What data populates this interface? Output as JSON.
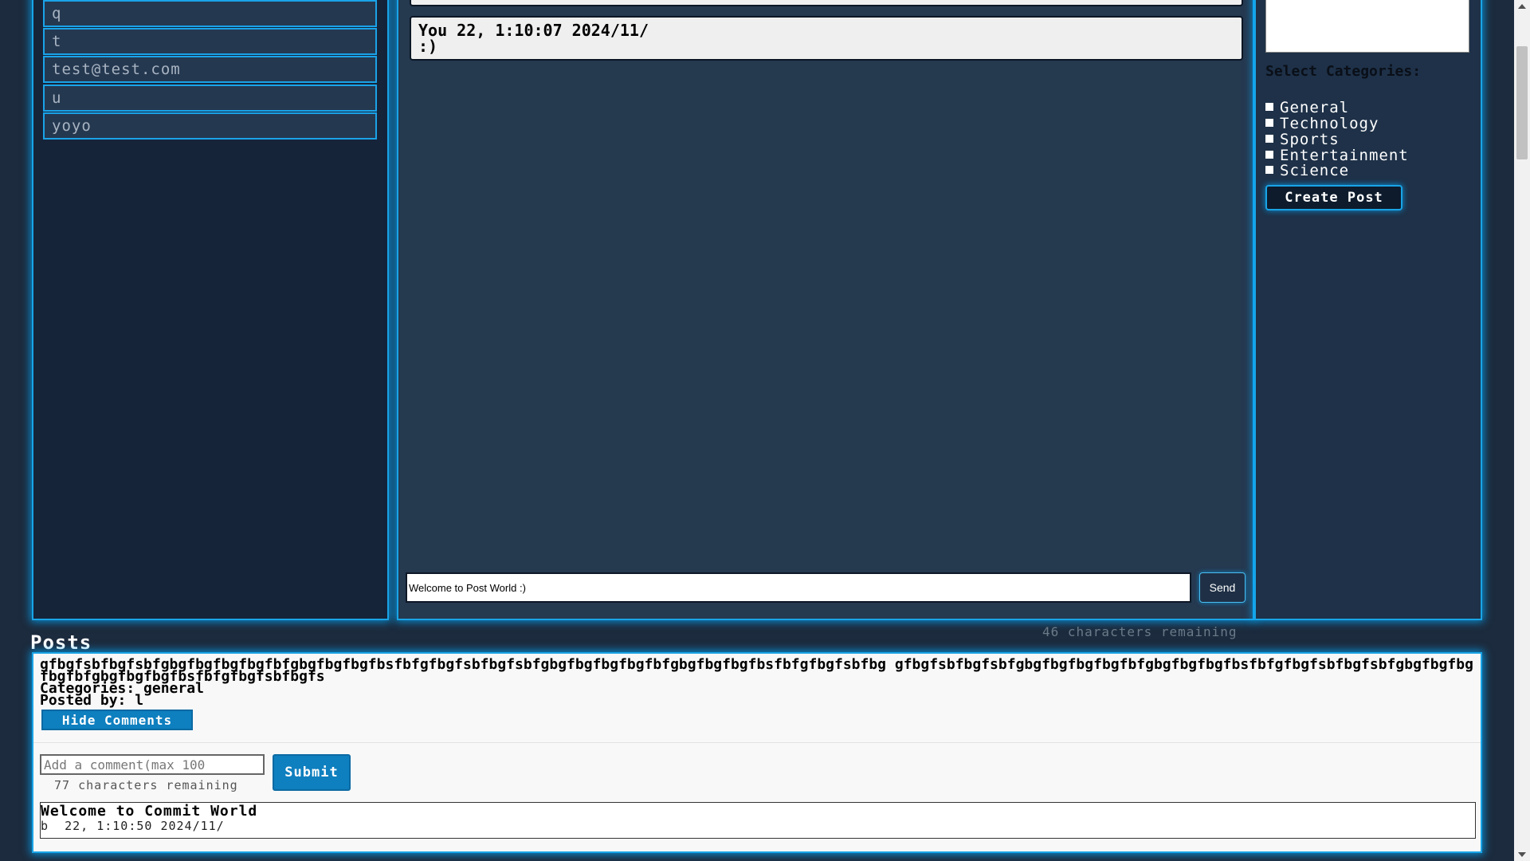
{
  "users": [
    "q",
    "t",
    "test@test.com",
    "u",
    "yoyo"
  ],
  "chat": {
    "message_sender": "You",
    "message_time": "22, 1:10:07 2024/11/",
    "message_text": ":)",
    "input_value": "Welcome to Post World :)",
    "send_label": "Send",
    "chars_remaining": "46 characters remaining"
  },
  "create_post": {
    "categories_title": "Select Categories:",
    "categories": [
      "General",
      "Technology",
      "Sports",
      "Entertainment",
      "Science"
    ],
    "create_label": "Create Post"
  },
  "posts": {
    "heading": "Posts",
    "post": {
      "content": "gfbgfsbfbgfsbfgbgfbgfbgfbgfbfgbgfbgfbgfbsfbfgfbgfsbfbgfsbfgbgfbgfbgfbgfbfgbgfbgfbgfbsfbfgfbgfsbfbg gfbgfsbfbgfsbfgbgfbgfbgfbgfbfgbgfbgfbgfbsfbfgfbgfsbfbgfsbfgbgfbgfbgfbgfbfgbgfbgfbgfbsfbfgfbgfsbfbgfs",
      "categories_label": "Categories: general",
      "posted_by_label": "Posted by: l",
      "hide_comments_label": "Hide Comments",
      "comment_placeholder": "Add a comment(max 100",
      "comment_chars_remaining": "77 characters remaining",
      "submit_label": "Submit",
      "comment": {
        "text": "Welcome to Commit World",
        "author": "b",
        "time": "22, 1:10:50 2024/11/"
      }
    }
  },
  "colors": {
    "background": "#1c2b3d",
    "accent_glow": "#19a4e6",
    "button_blue": "#0e7fbf"
  }
}
